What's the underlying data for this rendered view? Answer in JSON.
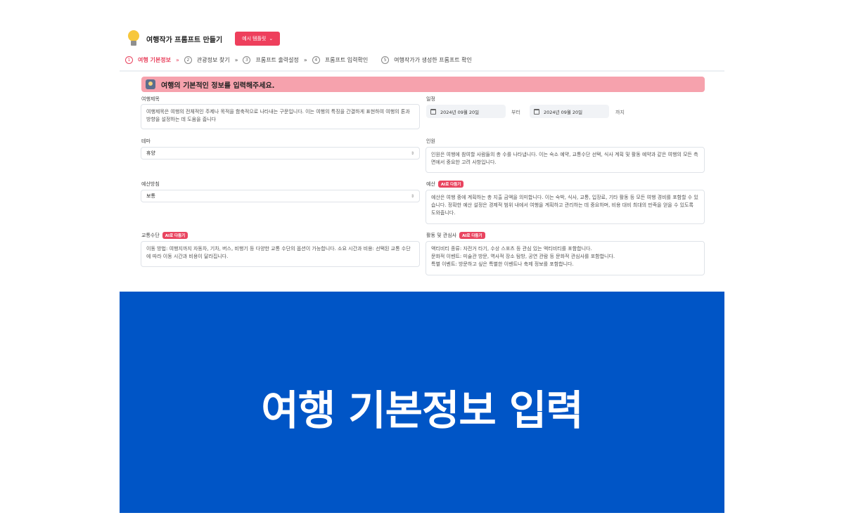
{
  "header": {
    "title": "여행작가 프롬프트 만들기",
    "example_button": "예시 템플릿",
    "example_chevron": "⌄"
  },
  "steps": [
    {
      "num": "1",
      "label": "여행 기본정보",
      "active": true
    },
    {
      "num": "2",
      "label": "관광정보 찾기",
      "active": false
    },
    {
      "num": "3",
      "label": "프롬프트 출력설정",
      "active": false
    },
    {
      "num": "4",
      "label": "프롬프트 입력확인",
      "active": false
    },
    {
      "num": "5",
      "label": "여행작가가 생성한 프롬프트 확인",
      "active": false
    }
  ],
  "step_separator": "»",
  "banner": {
    "text": "여행의 기본적인 정보를 입력해주세요."
  },
  "form": {
    "trip_title": {
      "label": "여행제목",
      "placeholder": "여행제목은 여행의 전체적인 주제나 목적을 함축적으로 나타내는 구문입니다. 이는 여행의 특징을 간결하게 표현하여 여행의 톤과 방향을 설정하는 데 도움을 줍니다"
    },
    "schedule": {
      "label": "일정",
      "start_date": "2024년 09월 20일",
      "from_text": "부터",
      "end_date": "2024년 09월 20일",
      "to_text": "까지"
    },
    "theme": {
      "label": "테마",
      "value": "휴양",
      "arrow": "⇕"
    },
    "people": {
      "label": "인원",
      "placeholder": "인원은 여행에 참여할 사람들의 총 수를 나타냅니다. 이는 숙소 예약, 교통수단 선택, 식사 계획 및 활동 예약과 같은 여행의 모든 측면에서 중요한 고려 사항입니다."
    },
    "budget_level": {
      "label": "예산방침",
      "value": "보통",
      "arrow": "⇕"
    },
    "budget": {
      "label": "예산",
      "tag": "AI로 다듬기",
      "placeholder": "예산은 여행 중에 계획하는 총 지출 금액을 의미합니다. 이는 숙박, 식사, 교통, 입장료, 기타 활동 등 모든 여행 경비를 포함할 수 있습니다. 정확한 예산 설정은 경제적 범위 내에서 여행을 계획하고 관리하는 데 중요하며, 비용 대비 최대의 만족을 얻을 수 있도록 도와줍니다."
    },
    "transport": {
      "label": "교통수단",
      "tag": "AI로 다듬기",
      "placeholder": "이동 방법: 여행지까지 자동차, 기차, 버스, 비행기 등 다양한 교통 수단의 옵션이 가능합니다. 소요 시간과 비용: 선택된 교통 수단에 따라 이동 시간과 비용이 달라집니다."
    },
    "activities": {
      "label": "활동 및 관심사",
      "tag": "AI로 다듬기",
      "lines": [
        "액티비티 종류: 자전거 타기, 수상 스포츠 등 관심 있는 액티비티를 포함합니다.",
        "문화적 이벤트: 미술관 방문, 역사적 장소 탐방, 공연 관람 등 문화적 관심사를 포함합니다.",
        "특별 이벤트: 방문하고 싶은 특별한 이벤트나 축제 정보를 포함합니다."
      ]
    }
  },
  "title_card": {
    "text": "여행 기본정보 입력"
  },
  "colors": {
    "accent": "#e94560",
    "banner_bg": "#f6a2ad",
    "card_bg": "#0055c6"
  }
}
